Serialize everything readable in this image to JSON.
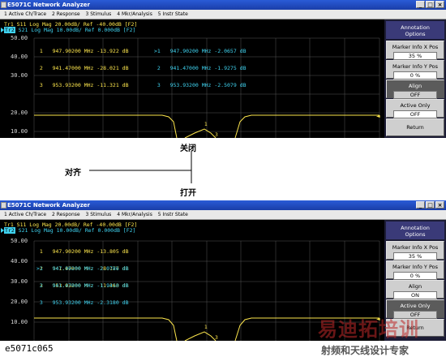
{
  "top": {
    "window_title": "E5071C Network Analyzer",
    "menu": [
      "1 Active Ch/Trace",
      "2 Response",
      "3 Stimulus",
      "4 Mkr/Analysis",
      "5 Instr State"
    ],
    "trace1": "Tr1 S11 Log Mag 20.00dB/ Ref -40.00dB [F2]",
    "trace2_id": "Tr2",
    "trace2_rest": " S21 Log Mag 10.00dB/ Ref 0.000dB [F2]",
    "y_labels": [
      "50.00",
      "40.00",
      "30.00",
      "20.00",
      "10.00"
    ],
    "markers_s11": [
      " 1   947.90200 MHz -13.922 dB",
      " 2   941.47000 MHz -28.021 dB",
      " 3   953.93200 MHz -11.321 dB"
    ],
    "markers_s21": [
      ">1   947.90200 MHz -2.0657 dB",
      " 2   941.47000 MHz -1.9275 dB",
      " 3   953.93200 MHz -2.5079 dB"
    ]
  },
  "bottom": {
    "window_title": "E5071C Network Analyzer",
    "menu": [
      "1 Active Ch/Trace",
      "2 Response",
      "3 Stimulus",
      "4 Mkr/Analysis",
      "5 Instr State"
    ],
    "trace1": "Tr1 S11 Log Mag 20.00dB/ Ref -40.00dB [F2]",
    "trace2_id": "Tr2",
    "trace2_rest": " S21 Log Mag 10.00dB/ Ref 0.000dB [F2]",
    "y_labels": [
      "50.00",
      "40.00",
      "30.00",
      "20.00",
      "10.00"
    ],
    "markers": [
      " 1   947.90200 MHz -13.805 dB",
      " 2   941.47000 MHz -28.177 dB",
      " 3   953.93200 MHz -11.363 dB",
      ">1   947.90200 MHz -2.0786 dB",
      " 2   941.47000 MHz -1.9410 dB",
      " 3   953.93200 MHz -2.3180 dB"
    ]
  },
  "softkeys": {
    "head": [
      "Annotation",
      "Options"
    ],
    "marker_x_label": "Marker Info X Pos",
    "marker_x_value": "35 %",
    "marker_y_label": "Marker Info Y Pos",
    "marker_y_value": "0 %",
    "align_label": "Align",
    "active_only_label": "Active Only",
    "return_label": "Return"
  },
  "top_state": {
    "align": "OFF",
    "active_only": "OFF"
  },
  "bottom_state": {
    "align": "ON",
    "active_only": "OFF"
  },
  "annotations": {
    "close": "关闭",
    "align": "对齐",
    "open": "打开"
  },
  "caption": "e5071c065",
  "watermark": {
    "logo": "易迪拓培训",
    "slogan": "射频和天线设计专家"
  },
  "colors": {
    "s11_trace": "#fde64d",
    "s21_trace": "#3fd3f0",
    "plot_bg": "#000000",
    "grid": "#555555"
  }
}
